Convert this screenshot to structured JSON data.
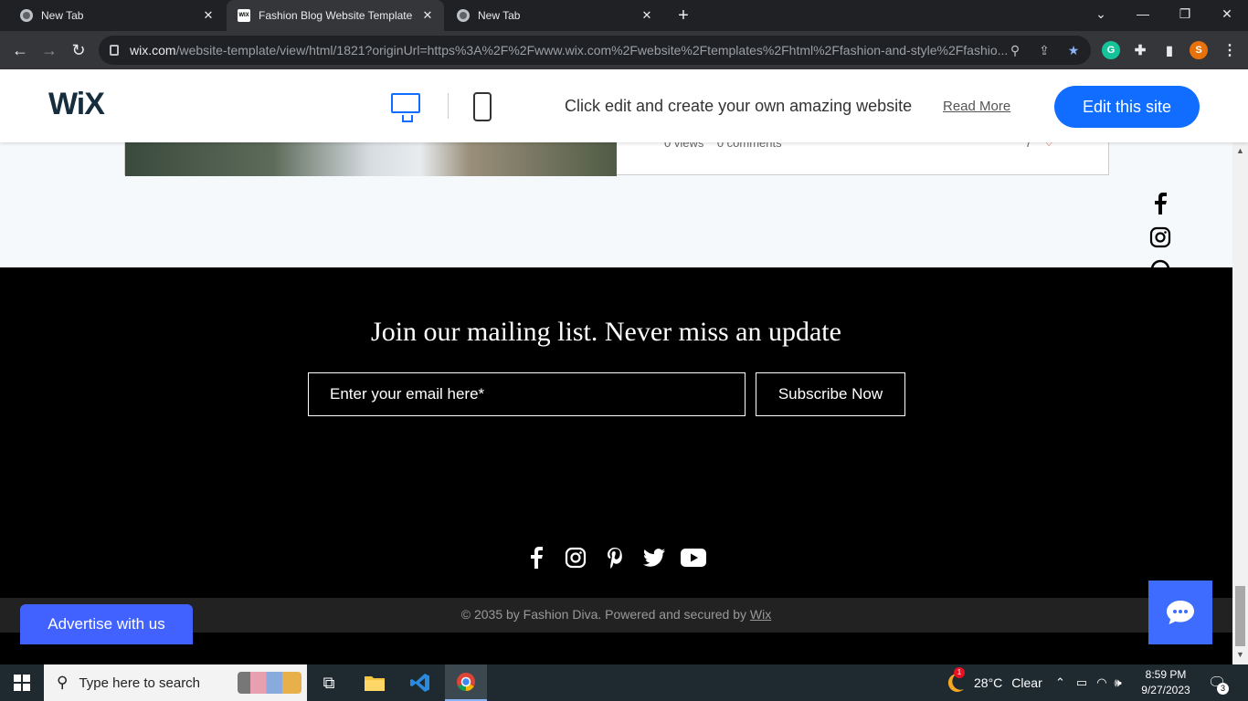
{
  "browser": {
    "tabs": [
      {
        "title": "New Tab",
        "active": false
      },
      {
        "title": "Fashion Blog Website Template |",
        "active": true,
        "favicon_text": "WIX"
      },
      {
        "title": "New Tab",
        "active": false
      }
    ],
    "url_host": "wix.com",
    "url_path": "/website-template/view/html/1821?originUrl=https%3A%2F%2Fwww.wix.com%2Fwebsite%2Ftemplates%2Fhtml%2Ffashion-and-style%2Ffashio...",
    "profile_initial": "S"
  },
  "wix_bar": {
    "logo": "WiX",
    "promo_text": "Click edit and create your own amazing website",
    "read_more": "Read More",
    "edit_button": "Edit this site"
  },
  "post": {
    "views": "0 views",
    "comments": "0 comments",
    "likes": "7"
  },
  "footer": {
    "mailing_title": "Join our mailing list. Never miss an update",
    "email_placeholder": "Enter your email here*",
    "subscribe_button": "Subscribe Now",
    "copyright_prefix": "© 2035 by Fashion Diva. Powered and secured by ",
    "copyright_link": "Wix",
    "social_icons": [
      "facebook-icon",
      "instagram-icon",
      "pinterest-icon",
      "twitter-icon",
      "youtube-icon"
    ]
  },
  "advertise_button": "Advertise with us",
  "taskbar": {
    "search_placeholder": "Type here to search",
    "temperature": "28°C",
    "weather_text": "Clear",
    "time": "8:59 PM",
    "date": "9/27/2023",
    "notification_count": "3",
    "weather_badge": "1"
  },
  "colors": {
    "wix_blue": "#116dff",
    "advertise_blue": "#4262ff",
    "chat_blue": "#3d6cff",
    "footer_bg": "#000000"
  }
}
